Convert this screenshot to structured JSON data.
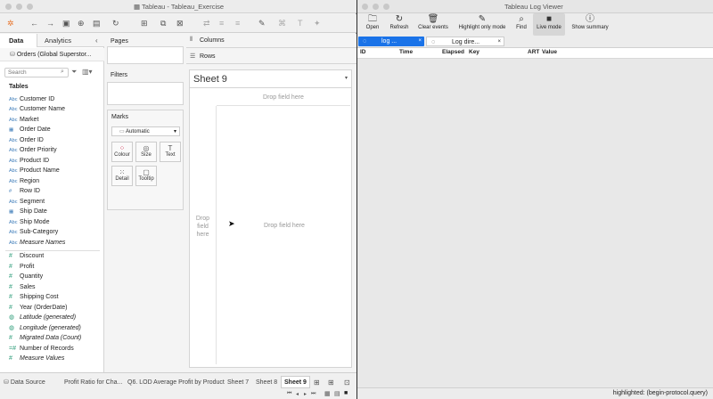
{
  "tableau": {
    "window_title": "Tableau - Tableau_Exercise",
    "side_tabs": {
      "data": "Data",
      "analytics": "Analytics"
    },
    "data_source": "Orders (Global Superstor...",
    "search_placeholder": "Search",
    "tables_header": "Tables",
    "dimensions": [
      {
        "type": "Abc",
        "label": "Customer ID",
        "italic": false
      },
      {
        "type": "Abc",
        "label": "Customer Name",
        "italic": false
      },
      {
        "type": "Abc",
        "label": "Market",
        "italic": false
      },
      {
        "type": "date",
        "label": "Order Date",
        "italic": false
      },
      {
        "type": "Abc",
        "label": "Order ID",
        "italic": false
      },
      {
        "type": "Abc",
        "label": "Order Priority",
        "italic": false
      },
      {
        "type": "Abc",
        "label": "Product ID",
        "italic": false
      },
      {
        "type": "Abc",
        "label": "Product Name",
        "italic": false
      },
      {
        "type": "Abc",
        "label": "Region",
        "italic": false
      },
      {
        "type": "#",
        "label": "Row ID",
        "italic": false
      },
      {
        "type": "Abc",
        "label": "Segment",
        "italic": false
      },
      {
        "type": "date",
        "label": "Ship Date",
        "italic": false
      },
      {
        "type": "Abc",
        "label": "Ship Mode",
        "italic": false
      },
      {
        "type": "Abc",
        "label": "Sub-Category",
        "italic": false
      },
      {
        "type": "Abc",
        "label": "Measure Names",
        "italic": true
      }
    ],
    "measures": [
      {
        "type": "#",
        "label": "Discount",
        "italic": false
      },
      {
        "type": "#",
        "label": "Profit",
        "italic": false
      },
      {
        "type": "#",
        "label": "Quantity",
        "italic": false
      },
      {
        "type": "#",
        "label": "Sales",
        "italic": false
      },
      {
        "type": "#",
        "label": "Shipping Cost",
        "italic": false
      },
      {
        "type": "#",
        "label": "Year (OrderDate)",
        "italic": false
      },
      {
        "type": "globe",
        "label": "Latitude (generated)",
        "italic": true
      },
      {
        "type": "globe",
        "label": "Longitude (generated)",
        "italic": true
      },
      {
        "type": "#",
        "label": "Migrated Data (Count)",
        "italic": true
      },
      {
        "type": "=#",
        "label": "Number of Records",
        "italic": false
      },
      {
        "type": "#",
        "label": "Measure Values",
        "italic": true
      }
    ],
    "pages_label": "Pages",
    "filters_label": "Filters",
    "marks_label": "Marks",
    "mark_type": "Automatic",
    "mark_buttons": [
      "Colour",
      "Size",
      "Text",
      "Detail",
      "Tooltip"
    ],
    "columns_label": "Columns",
    "rows_label": "Rows",
    "sheet_title": "Sheet 9",
    "drop_field_here": "Drop field here",
    "drop_field_left": "Drop\nfield\nhere",
    "sheet_tabs": [
      "Data Source",
      "Profit Ratio for Cha...",
      "Q6. LOD Average Profit by Product",
      "Sheet 7",
      "Sheet 8",
      "Sheet 9"
    ],
    "active_sheet": "Sheet 9"
  },
  "log_viewer": {
    "window_title": "Tableau Log Viewer",
    "toolbar": [
      "Open",
      "Refresh",
      "Clear events",
      "Highlight only mode",
      "Find",
      "Live mode",
      "Show summary"
    ],
    "tabs": [
      {
        "label": "log ...",
        "active": true
      },
      {
        "label": "Log dire...",
        "active": false
      }
    ],
    "columns": [
      "ID",
      "Time",
      "Elapsed",
      "Key",
      "ART",
      "Value"
    ],
    "status": "highlighted: (begin-protocol.query)"
  },
  "colors": {
    "accent": "#1a73e8",
    "tableau_blue": "#3a7ab8",
    "measure_green": "#2e9d7a"
  }
}
